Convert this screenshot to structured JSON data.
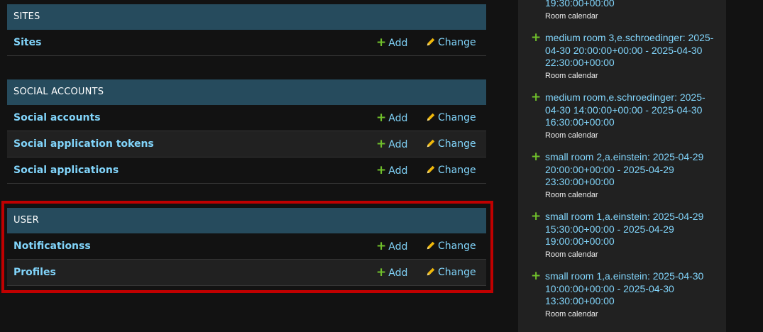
{
  "modules": {
    "sites": {
      "caption": "SITES",
      "rows": [
        {
          "name": "Sites",
          "add": "Add",
          "change": "Change"
        }
      ]
    },
    "social": {
      "caption": "SOCIAL ACCOUNTS",
      "rows": [
        {
          "name": "Social accounts",
          "add": "Add",
          "change": "Change"
        },
        {
          "name": "Social application tokens",
          "add": "Add",
          "change": "Change"
        },
        {
          "name": "Social applications",
          "add": "Add",
          "change": "Change"
        }
      ]
    },
    "user": {
      "caption": "USER",
      "rows": [
        {
          "name": "Notificationss",
          "add": "Add",
          "change": "Change"
        },
        {
          "name": "Profiles",
          "add": "Add",
          "change": "Change"
        }
      ]
    }
  },
  "recent_actions": {
    "top_partial": {
      "text": "19:30:00+00:00",
      "type": "Room calendar"
    },
    "items": [
      {
        "text": "medium room 3,e.schroedinger: 2025-04-30 20:00:00+00:00 - 2025-04-30 22:30:00+00:00",
        "type": "Room calendar"
      },
      {
        "text": "medium room,e.schroedinger: 2025-04-30 14:00:00+00:00 - 2025-04-30 16:30:00+00:00",
        "type": "Room calendar"
      },
      {
        "text": "small room 2,a.einstein: 2025-04-29 20:00:00+00:00 - 2025-04-29 23:30:00+00:00",
        "type": "Room calendar"
      },
      {
        "text": "small room 1,a.einstein: 2025-04-29 15:30:00+00:00 - 2025-04-29 19:00:00+00:00",
        "type": "Room calendar"
      },
      {
        "text": "small room 1,a.einstein: 2025-04-30 10:00:00+00:00 - 2025-04-30 13:30:00+00:00",
        "type": "Room calendar"
      }
    ]
  },
  "colors": {
    "background": "#121212",
    "caption_bg": "#264b5d",
    "link": "#81d4fa",
    "add_plus": "#70bf2b",
    "change_pencil": "#efb80b",
    "highlight_border": "#c00000",
    "sidebar_bg": "#212121"
  }
}
